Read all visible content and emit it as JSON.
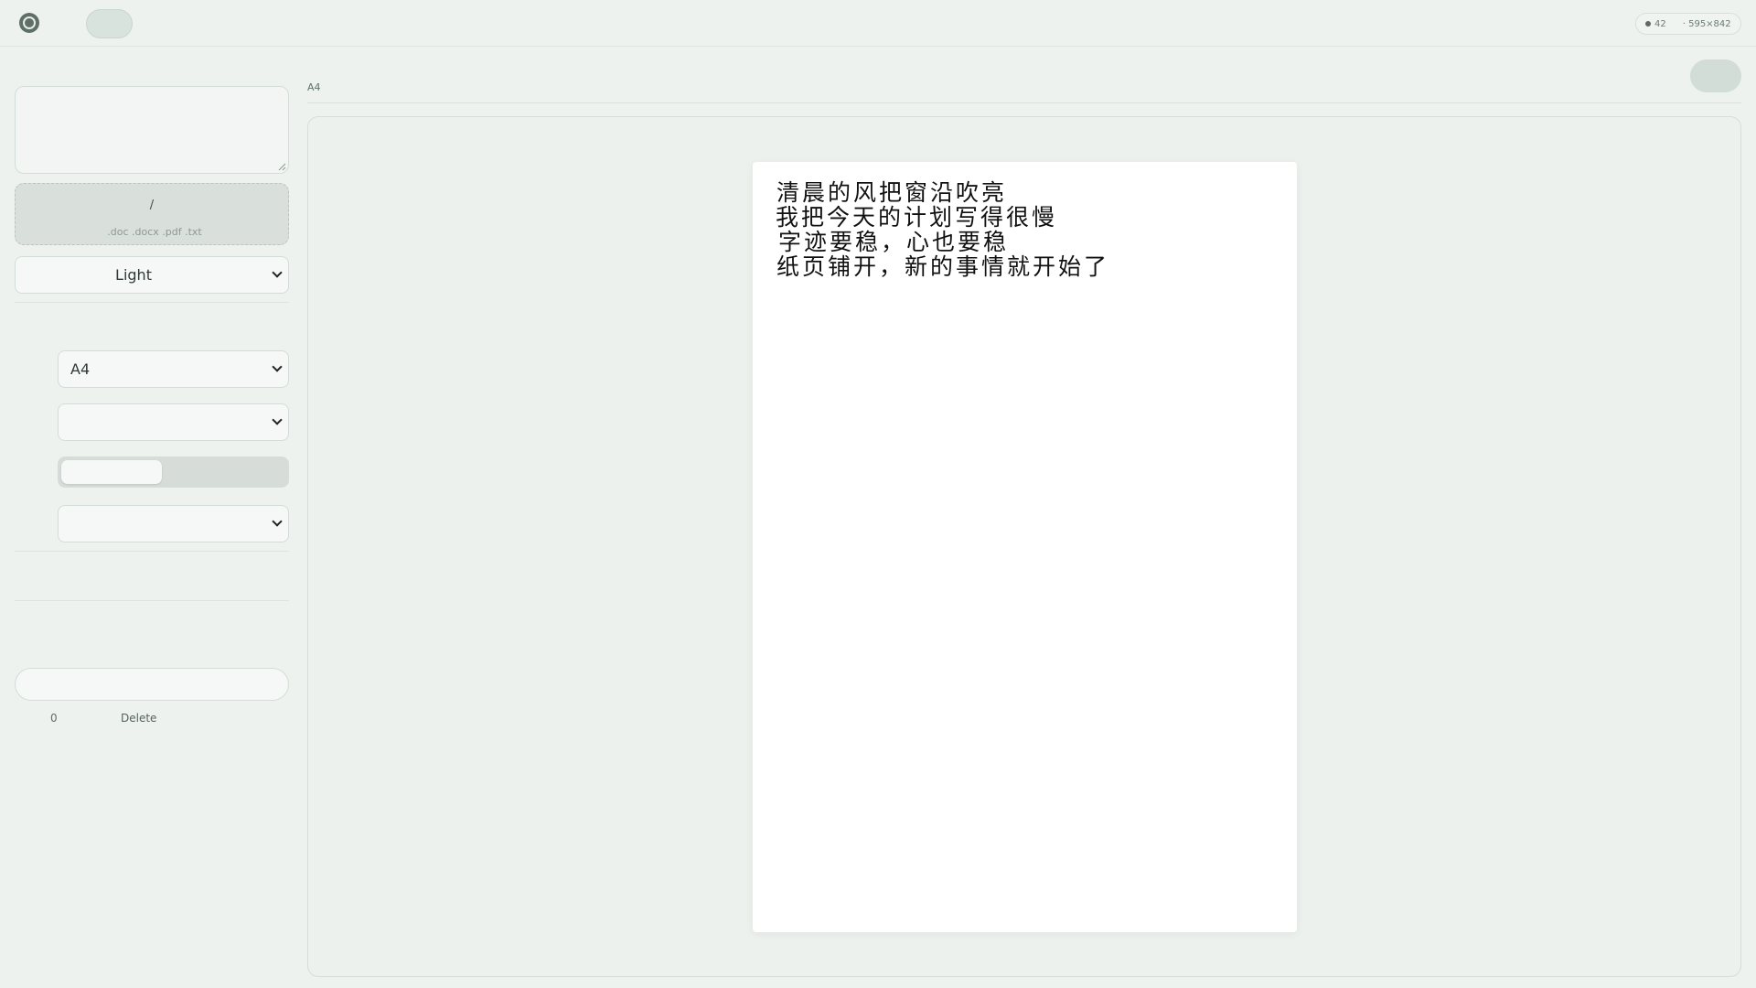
{
  "topbar": {
    "status": {
      "count": "42",
      "size": "· 595×842"
    }
  },
  "sidebar": {
    "text_input": {
      "value": "",
      "placeholder": ""
    },
    "upload": {
      "title": "/",
      "hint": ".doc .docx .pdf .txt"
    },
    "theme_select": {
      "value": "Light"
    },
    "page_size_select": {
      "value": "A4"
    },
    "select_2": {
      "value": ""
    },
    "slider": {
      "value_fraction": 0.45
    },
    "select_3": {
      "value": ""
    },
    "search": {
      "value": "",
      "placeholder": ""
    },
    "counter": "0",
    "delete_label": "Delete"
  },
  "main": {
    "paper_label": "A4",
    "page_lines": [
      "清晨的风把窗沿吹亮",
      "我把今天的计划写得很慢",
      "字迹要稳，心也要稳",
      "纸页铺开，新的事情就开始了"
    ]
  },
  "colors": {
    "background": "#eef2ef",
    "panel": "#edf1ee",
    "paper": "#ffffff",
    "pill": "#d7e3dc"
  },
  "icons": {
    "logo": "app-logo-icon",
    "select_arrow": "chevron-down-icon"
  }
}
